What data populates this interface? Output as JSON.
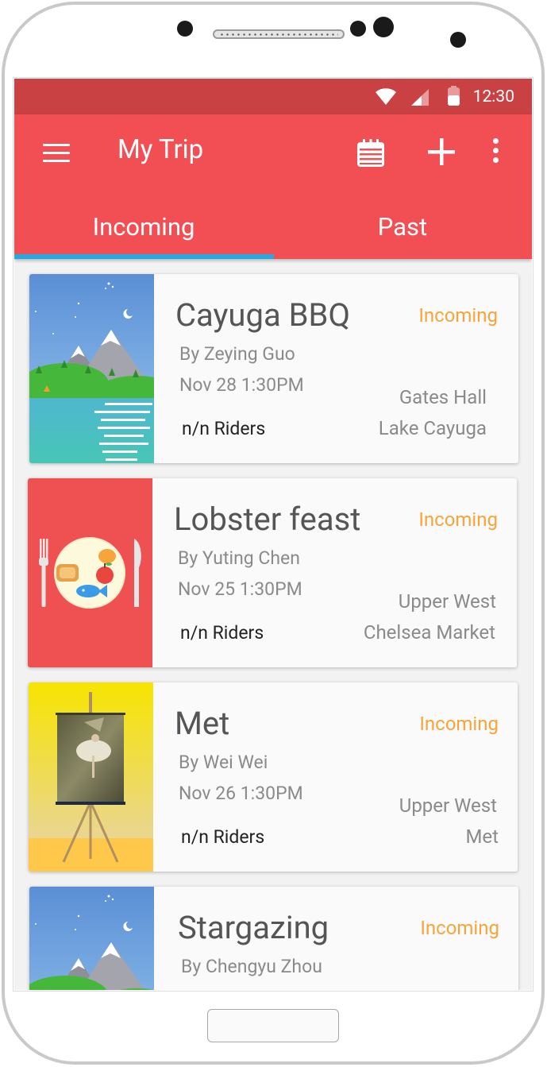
{
  "status_bar": {
    "time": "12:30"
  },
  "app_bar": {
    "title": "My Trip"
  },
  "tabs": [
    {
      "label": "Incoming",
      "selected": true
    },
    {
      "label": "Past",
      "selected": false
    }
  ],
  "colors": {
    "app_bar": "#f14f53",
    "status_bar": "#c94143",
    "tab_indicator": "#28a7e0",
    "status_text": "#f7a43a"
  },
  "trips": [
    {
      "title": "Cayuga BBQ",
      "status": "Incoming",
      "author": "By Zeying Guo",
      "date": "Nov 28 1:30PM",
      "riders": "n/n Riders",
      "from": "Gates Hall",
      "to": "Lake Cayuga",
      "image": "mountain-lake-illustration"
    },
    {
      "title": "Lobster feast",
      "status": "Incoming",
      "author": "By Yuting Chen",
      "date": "Nov 25 1:30PM",
      "riders": "n/n Riders",
      "from": "Upper West",
      "to": "Chelsea Market",
      "image": "food-plate-illustration"
    },
    {
      "title": "Met",
      "status": "Incoming",
      "author": "By Wei Wei",
      "date": "Nov 26 1:30PM",
      "riders": "n/n Riders",
      "from": "Upper West",
      "to": "Met",
      "image": "easel-painting-illustration"
    },
    {
      "title": "Stargazing",
      "status": "Incoming",
      "author": "By Chengyu Zhou",
      "image": "mountain-lake-illustration"
    }
  ]
}
